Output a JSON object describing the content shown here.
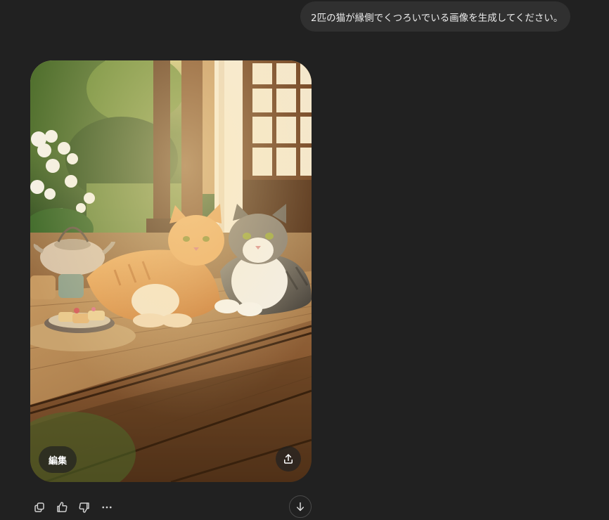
{
  "user_message": {
    "text": "2匹の猫が縁側でくつろいでいる画像を生成してください。"
  },
  "generated_image": {
    "edit_label": "編集",
    "share_icon": "share-upload-icon"
  },
  "message_actions": {
    "icons": [
      "copy-icon",
      "thumbs-up-icon",
      "thumbs-down-icon",
      "more-options-icon"
    ]
  },
  "scroll": {
    "icon": "arrow-down-icon"
  },
  "colors": {
    "background": "#212121",
    "bubble": "#303030",
    "text": "#ececec"
  }
}
